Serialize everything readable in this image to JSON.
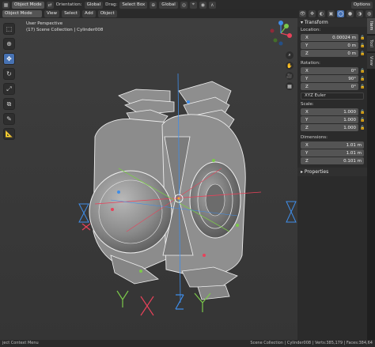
{
  "header": {
    "mode": "Object Mode",
    "orientation_label": "Orientation:",
    "orientation_value": "Global",
    "drag_label": "Drag:",
    "drag_value": "Select Box",
    "transform_space": "Global",
    "options": "Options"
  },
  "menu": {
    "view": "View",
    "select": "Select",
    "add": "Add",
    "object": "Object"
  },
  "viewport": {
    "view_name": "User Perspective",
    "collection_path": "(17) Scene Collection | Cylinder008"
  },
  "sidebar": {
    "tabs": [
      "Item",
      "Tool",
      "View"
    ],
    "transform_title": "Transform",
    "location_label": "Location:",
    "location": {
      "x": "0.00024 m",
      "y": "0 m",
      "z": "0 m"
    },
    "rotation_label": "Rotation:",
    "rotation": {
      "x": "0°",
      "y": "90°",
      "z": "0°"
    },
    "rotation_mode": "XYZ Euler",
    "scale_label": "Scale:",
    "scale": {
      "x": "1.000",
      "y": "1.000",
      "z": "1.000"
    },
    "dimensions_label": "Dimensions:",
    "dimensions": {
      "x": "1.01 m",
      "y": "1.01 m",
      "z": "0.101 m"
    },
    "properties_title": "Properties",
    "axis_x": "X",
    "axis_y": "Y",
    "axis_z": "Z"
  },
  "status": {
    "left": "ject Context Menu",
    "right": "Scene Collection | Cylinder008 | Verts:385,179 | Faces:384,64"
  },
  "colors": {
    "accent": "#4772b3",
    "axis_x": "#e8425a",
    "axis_y": "#7bc94a",
    "axis_z": "#3f8de8"
  }
}
